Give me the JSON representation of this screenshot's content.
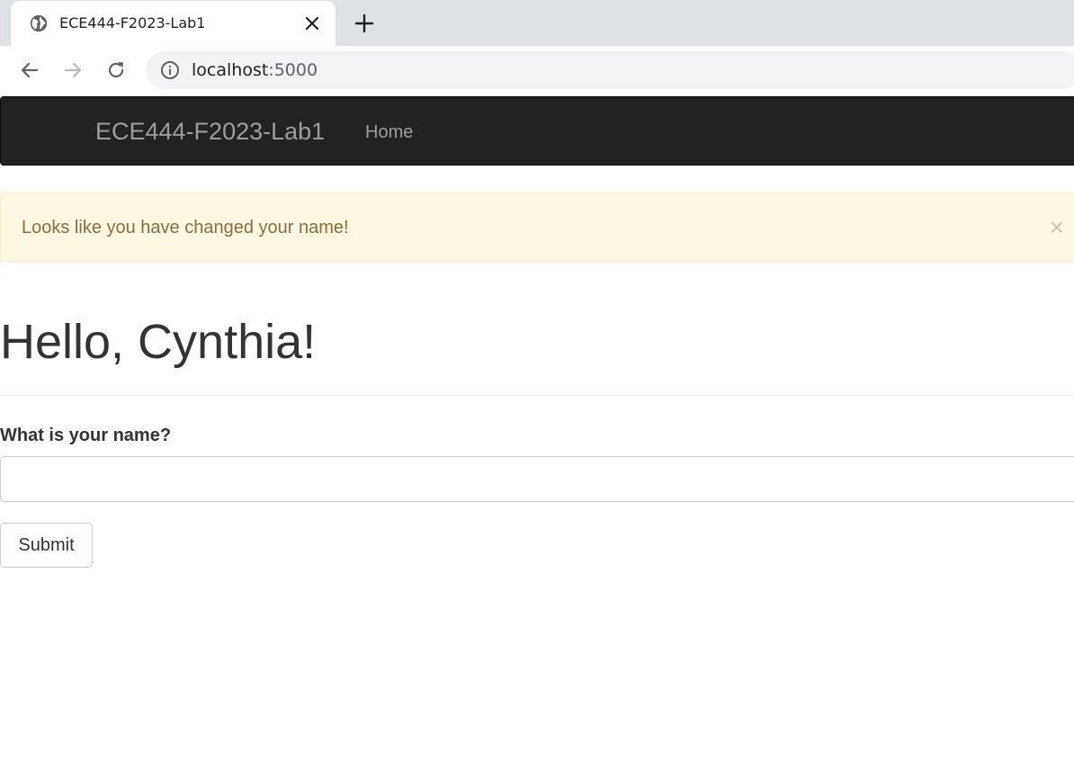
{
  "browser": {
    "tab": {
      "title": "ECE444-F2023-Lab1",
      "favicon": "globe-icon",
      "close_icon": "close-icon"
    },
    "new_tab_icon": "plus-icon",
    "toolbar": {
      "back_icon": "arrow-left-icon",
      "forward_icon": "arrow-right-icon",
      "reload_icon": "reload-icon",
      "site_info_icon": "info-icon"
    },
    "address": {
      "host": "localhost",
      "port": ":5000"
    }
  },
  "navbar": {
    "brand": "ECE444-F2023-Lab1",
    "links": [
      {
        "label": "Home"
      }
    ],
    "background": "#222222",
    "text_color": "#9d9d9d"
  },
  "alert": {
    "message": "Looks like you have changed your name!",
    "close_glyph": "×",
    "background": "#fcf8e3",
    "text_color": "#8a6d3b"
  },
  "page": {
    "greeting": "Hello, Cynthia!",
    "form": {
      "label": "What is your name?",
      "input_value": "",
      "submit_label": "Submit"
    }
  }
}
